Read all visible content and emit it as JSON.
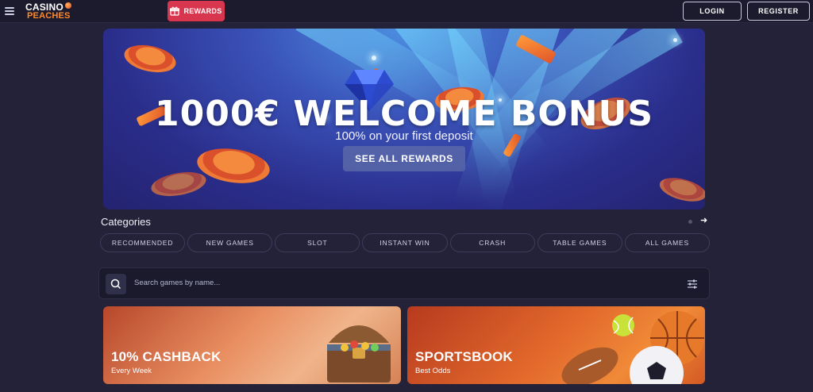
{
  "header": {
    "logo_line1": "CASINO",
    "logo_line2": "PEACHES",
    "rewards_label": "REWARDS",
    "login_label": "LOGIN",
    "register_label": "REGISTER"
  },
  "hero": {
    "title": "1000€ WELCOME BONUS",
    "subtitle": "100% on your first deposit",
    "cta_label": "SEE ALL REWARDS"
  },
  "categories": {
    "title": "Categories",
    "items": [
      {
        "label": "RECOMMENDED"
      },
      {
        "label": "NEW GAMES"
      },
      {
        "label": "SLOT"
      },
      {
        "label": "INSTANT WIN"
      },
      {
        "label": "CRASH"
      },
      {
        "label": "TABLE GAMES"
      },
      {
        "label": "ALL GAMES"
      }
    ]
  },
  "search": {
    "placeholder": "Search games by name..."
  },
  "promos": [
    {
      "title": "10% CASHBACK",
      "subtitle": "Every Week"
    },
    {
      "title": "SPORTSBOOK",
      "subtitle": "Best Odds"
    }
  ],
  "colors": {
    "background": "#232238",
    "topbar": "#1c1b2e",
    "rewards_button": "#d8364e",
    "hero_blue": "#3a52b9"
  },
  "icons": {
    "menu": "hamburger-icon",
    "rewards": "gift-icon",
    "search": "search-icon",
    "filter": "sliders-icon",
    "next": "arrow-right-icon"
  }
}
